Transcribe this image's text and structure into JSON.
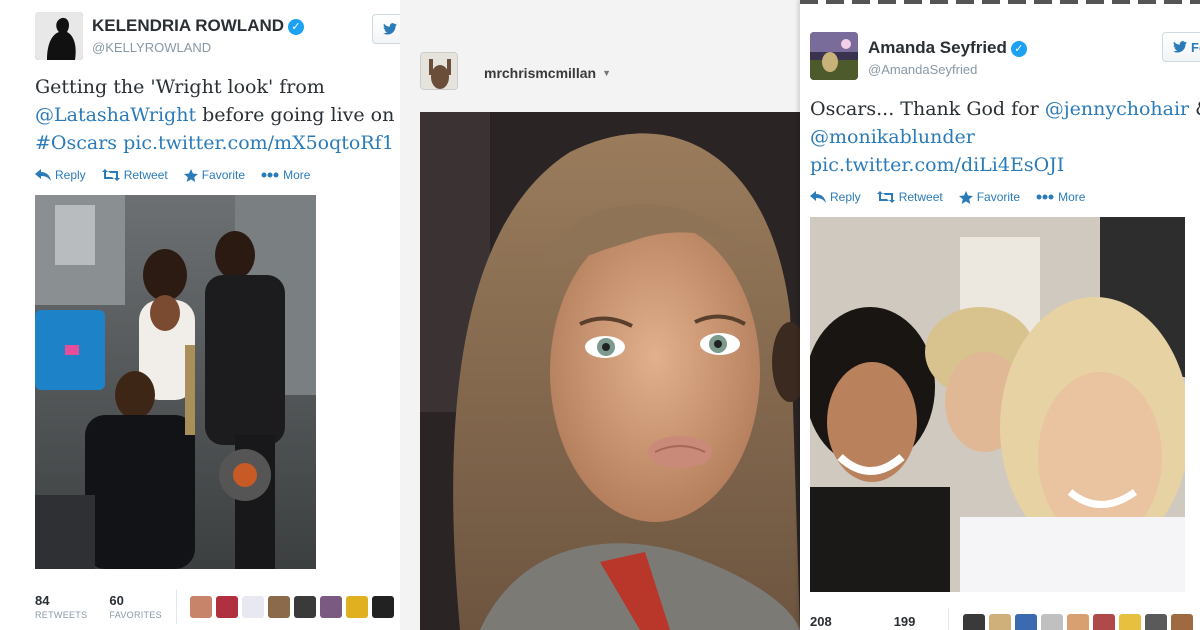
{
  "tweet1": {
    "name": "KELENDRIA ROWLAND",
    "handle": "@KELLYROWLAND",
    "text_line1": "Getting the 'Wright look' from",
    "mention": "@LatashaWright",
    "text_line2_rest": " before going live on",
    "hashtag": "#Oscars",
    "pic_link": "pic.twitter.com/mX5oqtoRf1",
    "actions": {
      "reply": "Reply",
      "retweet": "Retweet",
      "favorite": "Favorite",
      "more": "More"
    },
    "stats": {
      "retweets": "84",
      "retweets_label": "RETWEETS",
      "favorites": "60",
      "favorites_label": "FAVORITES"
    }
  },
  "instagram": {
    "username": "mrchrismcmillan"
  },
  "tweet2": {
    "name": "Amanda Seyfried",
    "handle": "@AmandaSeyfried",
    "text_start": "Oscars... Thank God for ",
    "mention1": "@jennychohair",
    "mention1_rest": " &",
    "mention2": "@monikablunder",
    "pic_link": "pic.twitter.com/diLi4EsOJI",
    "actions": {
      "reply": "Reply",
      "retweet": "Retweet",
      "favorite": "Favorite",
      "more": "More"
    },
    "follow_label": "Fo",
    "stats": {
      "retweets": "208",
      "favorites": "199"
    }
  },
  "colors": {
    "link": "#2b7bb9",
    "verified": "#1da1f2",
    "muted": "#8899a6"
  }
}
